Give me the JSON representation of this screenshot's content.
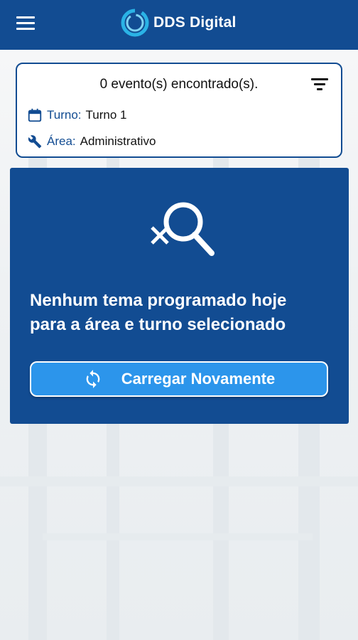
{
  "header": {
    "app_name": "DDS Digital",
    "menu_icon": "menu-icon",
    "logo_icon": "logo-ring-icon"
  },
  "filter_card": {
    "result_count_text": "0 evento(s) encontrado(s).",
    "filter_icon": "filter-list-icon",
    "shift": {
      "icon": "calendar-icon",
      "label": "Turno:",
      "value": "Turno 1"
    },
    "area": {
      "icon": "wrench-icon",
      "label": "Área:",
      "value": "Administrativo"
    }
  },
  "empty_state": {
    "icon": "search-off-icon",
    "message_line1": "Nenhum tema programado hoje",
    "message_line2": "para a área e turno selecionado",
    "reload_button": {
      "icon": "sync-icon",
      "label": "Carregar Novamente"
    }
  },
  "colors": {
    "primary": "#124c92",
    "button": "#2c95eb",
    "logo_accent": "#2ab3e6",
    "background": "#f2f4f5"
  }
}
